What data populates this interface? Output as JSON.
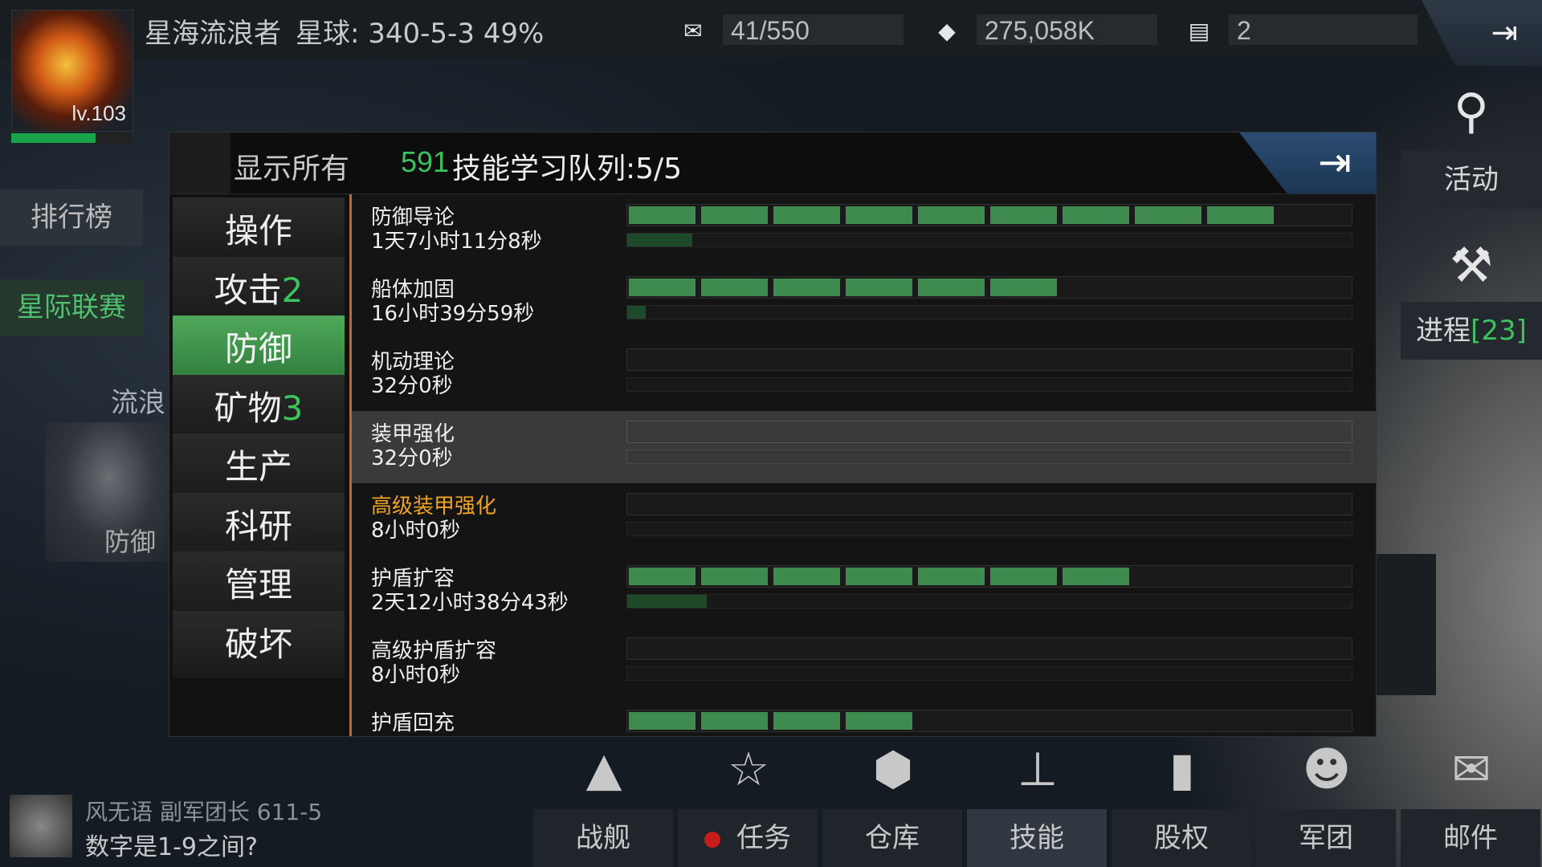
{
  "player": {
    "level": "lv.103",
    "name": "星海流浪者",
    "planet": "星球: 340-5-3  49%",
    "xp_fraction": 0.7
  },
  "resources": [
    {
      "icon": "ship-capacity-icon",
      "value": "41/550"
    },
    {
      "icon": "credits-icon",
      "value": "275,058K"
    },
    {
      "icon": "cards-icon",
      "value": "2"
    }
  ],
  "left_buttons": {
    "ranking": "排行榜",
    "league": "星际联赛",
    "wander": "流浪",
    "defense_thumb": "防御"
  },
  "right_buttons": {
    "activity": "活动",
    "progress": "进程",
    "progress_count": "[23]"
  },
  "panel": {
    "show_all": "显示所有",
    "points": "591",
    "queue": "技能学习队列:5/5",
    "categories": [
      {
        "label": "操作",
        "num": ""
      },
      {
        "label": "攻击",
        "num": "2"
      },
      {
        "label": "防御",
        "num": "",
        "active": true
      },
      {
        "label": "矿物",
        "num": "3"
      },
      {
        "label": "生产",
        "num": ""
      },
      {
        "label": "科研",
        "num": ""
      },
      {
        "label": "管理",
        "num": ""
      },
      {
        "label": "破坏",
        "num": ""
      }
    ],
    "skills": [
      {
        "name": "防御导论",
        "time": "1天7小时11分8秒",
        "level": 9,
        "max": 10,
        "progress": 0.09
      },
      {
        "name": "船体加固",
        "time": "16小时39分59秒",
        "level": 6,
        "max": 10,
        "progress": 0.025
      },
      {
        "name": "机动理论",
        "time": "32分0秒",
        "level": 0,
        "max": 10,
        "progress": 0
      },
      {
        "name": "装甲强化",
        "time": "32分0秒",
        "level": 0,
        "max": 10,
        "progress": 0,
        "selected": true
      },
      {
        "name": "高级装甲强化",
        "time": "8小时0秒",
        "level": 0,
        "max": 10,
        "progress": 0,
        "advanced": true
      },
      {
        "name": "护盾扩容",
        "time": "2天12小时38分43秒",
        "level": 7,
        "max": 10,
        "progress": 0.11
      },
      {
        "name": "高级护盾扩容",
        "time": "8小时0秒",
        "level": 0,
        "max": 10,
        "progress": 0
      },
      {
        "name": "护盾回充",
        "time": "",
        "level": 4,
        "max": 10,
        "progress": 0
      }
    ]
  },
  "nav": [
    {
      "label": "战舰",
      "icon": "warship-icon",
      "glyph": "▲"
    },
    {
      "label": "任务",
      "icon": "mission-icon",
      "glyph": "☆",
      "alert": true
    },
    {
      "label": "仓库",
      "icon": "warehouse-icon",
      "glyph": "⬢"
    },
    {
      "label": "技能",
      "icon": "skill-tree-icon",
      "glyph": "⊥",
      "active": true
    },
    {
      "label": "股权",
      "icon": "equity-chart-icon",
      "glyph": "▮"
    },
    {
      "label": "军团",
      "icon": "legion-icon",
      "glyph": "☻"
    },
    {
      "label": "邮件",
      "icon": "mail-icon",
      "glyph": "✉"
    }
  ],
  "chat": {
    "sender": "风无语 副军团长 611-5",
    "message": "数字是1-9之间?"
  }
}
